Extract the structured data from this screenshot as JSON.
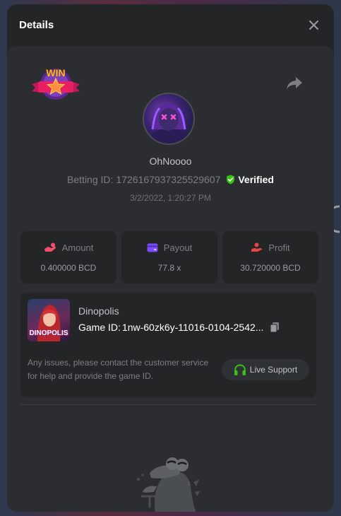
{
  "modal": {
    "title": "Details"
  },
  "bet": {
    "username": "OhNoooo",
    "betting_label": "Betting ID:",
    "betting_id": "1726167937325529607",
    "verified_label": "Verified",
    "timestamp": "3/2/2022, 1:20:27 PM"
  },
  "stats": {
    "amount_label": "Amount",
    "amount_value": "0.400000 BCD",
    "payout_label": "Payout",
    "payout_value": "77.8 x",
    "profit_label": "Profit",
    "profit_value": "30.720000 BCD"
  },
  "game": {
    "name": "Dinopolis",
    "thumb_text": "DINOPOLIS",
    "id_label": "Game ID:",
    "id_value": "1nw-60zk6y-11016-0104-2542...",
    "support_text": "Any issues, please contact the customer service for help and provide the game ID.",
    "support_button": "Live Support"
  },
  "badge": {
    "text": "WIN"
  },
  "colors": {
    "verified_green": "#3bc117",
    "amount_icon": "#f0506e",
    "payout_icon": "#7b4cff",
    "profit_icon": "#e84545",
    "support_icon": "#3bc117"
  }
}
